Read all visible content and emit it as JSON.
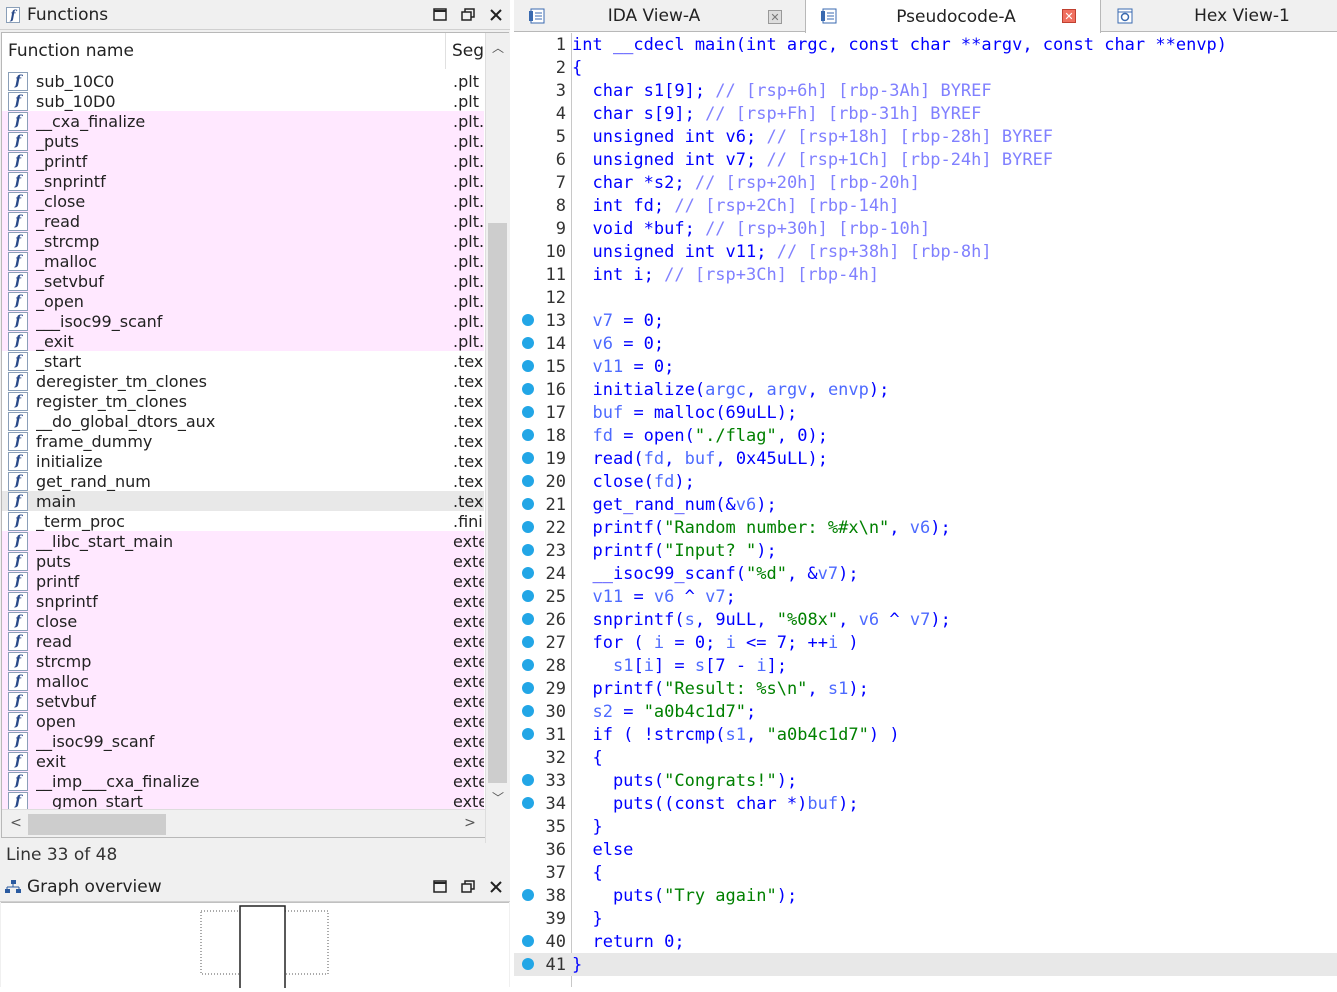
{
  "functions_panel": {
    "title": "Functions",
    "col_name": "Function name",
    "col_seg": "Seg",
    "rows": [
      {
        "name": "sub_10C0",
        "seg": ".plt",
        "pink": false
      },
      {
        "name": "sub_10D0",
        "seg": ".plt",
        "pink": false
      },
      {
        "name": "__cxa_finalize",
        "seg": ".plt.",
        "pink": true
      },
      {
        "name": "_puts",
        "seg": ".plt.",
        "pink": true
      },
      {
        "name": "_printf",
        "seg": ".plt.",
        "pink": true
      },
      {
        "name": "_snprintf",
        "seg": ".plt.",
        "pink": true
      },
      {
        "name": "_close",
        "seg": ".plt.",
        "pink": true
      },
      {
        "name": "_read",
        "seg": ".plt.",
        "pink": true
      },
      {
        "name": "_strcmp",
        "seg": ".plt.",
        "pink": true
      },
      {
        "name": "_malloc",
        "seg": ".plt.",
        "pink": true
      },
      {
        "name": "_setvbuf",
        "seg": ".plt.",
        "pink": true
      },
      {
        "name": "_open",
        "seg": ".plt.",
        "pink": true
      },
      {
        "name": "___isoc99_scanf",
        "seg": ".plt.s",
        "pink": true
      },
      {
        "name": "_exit",
        "seg": ".plt.",
        "pink": true
      },
      {
        "name": "_start",
        "seg": ".tex",
        "pink": false
      },
      {
        "name": "deregister_tm_clones",
        "seg": ".tex",
        "pink": false
      },
      {
        "name": "register_tm_clones",
        "seg": ".tex",
        "pink": false
      },
      {
        "name": "__do_global_dtors_aux",
        "seg": ".tex",
        "pink": false
      },
      {
        "name": "frame_dummy",
        "seg": ".tex",
        "pink": false
      },
      {
        "name": "initialize",
        "seg": ".tex",
        "pink": false
      },
      {
        "name": "get_rand_num",
        "seg": ".tex",
        "pink": false
      },
      {
        "name": "main",
        "seg": ".tex",
        "pink": false,
        "selected": true
      },
      {
        "name": "_term_proc",
        "seg": ".fini",
        "pink": false
      },
      {
        "name": "__libc_start_main",
        "seg": "exte",
        "pink": true
      },
      {
        "name": "puts",
        "seg": "exte",
        "pink": true
      },
      {
        "name": "printf",
        "seg": "exte",
        "pink": true
      },
      {
        "name": "snprintf",
        "seg": "exte",
        "pink": true
      },
      {
        "name": "close",
        "seg": "exte",
        "pink": true
      },
      {
        "name": "read",
        "seg": "exte",
        "pink": true
      },
      {
        "name": "strcmp",
        "seg": "exte",
        "pink": true
      },
      {
        "name": "malloc",
        "seg": "exte",
        "pink": true
      },
      {
        "name": "setvbuf",
        "seg": "exte",
        "pink": true
      },
      {
        "name": "open",
        "seg": "exte",
        "pink": true
      },
      {
        "name": "__isoc99_scanf",
        "seg": "exte",
        "pink": true
      },
      {
        "name": "exit",
        "seg": "exte",
        "pink": true
      },
      {
        "name": "__imp___cxa_finalize",
        "seg": "exte",
        "pink": true
      },
      {
        "name": "__gmon_start__",
        "seg": "exte",
        "pink": true
      }
    ],
    "status": "Line 33 of 48"
  },
  "graph_panel": {
    "title": "Graph overview"
  },
  "tabs": [
    {
      "label": "IDA View-A",
      "active": false,
      "icon": "ida-view-icon"
    },
    {
      "label": "Pseudocode-A",
      "active": true,
      "icon": "pseudocode-icon"
    },
    {
      "label": "Hex View-1",
      "active": false,
      "icon": "hex-view-icon"
    }
  ],
  "code_lines": [
    {
      "n": "1",
      "bp": false,
      "segs": [
        [
          "k",
          "int __cdecl main(int argc, const char **argv, const char **envp)"
        ]
      ]
    },
    {
      "n": "2",
      "bp": false,
      "segs": [
        [
          "k",
          "{"
        ]
      ]
    },
    {
      "n": "3",
      "bp": false,
      "segs": [
        [
          "k",
          "  char s1[9]; "
        ],
        [
          "cm",
          "// [rsp+6h] [rbp-3Ah] BYREF"
        ]
      ]
    },
    {
      "n": "4",
      "bp": false,
      "segs": [
        [
          "k",
          "  char s[9]; "
        ],
        [
          "cm",
          "// [rsp+Fh] [rbp-31h] BYREF"
        ]
      ]
    },
    {
      "n": "5",
      "bp": false,
      "segs": [
        [
          "k",
          "  unsigned int v6; "
        ],
        [
          "cm",
          "// [rsp+18h] [rbp-28h] BYREF"
        ]
      ]
    },
    {
      "n": "6",
      "bp": false,
      "segs": [
        [
          "k",
          "  unsigned int v7; "
        ],
        [
          "cm",
          "// [rsp+1Ch] [rbp-24h] BYREF"
        ]
      ]
    },
    {
      "n": "7",
      "bp": false,
      "segs": [
        [
          "k",
          "  char *s2; "
        ],
        [
          "cm",
          "// [rsp+20h] [rbp-20h]"
        ]
      ]
    },
    {
      "n": "8",
      "bp": false,
      "segs": [
        [
          "k",
          "  int fd; "
        ],
        [
          "cm",
          "// [rsp+2Ch] [rbp-14h]"
        ]
      ]
    },
    {
      "n": "9",
      "bp": false,
      "segs": [
        [
          "k",
          "  void *buf; "
        ],
        [
          "cm",
          "// [rsp+30h] [rbp-10h]"
        ]
      ]
    },
    {
      "n": "10",
      "bp": false,
      "segs": [
        [
          "k",
          "  unsigned int v11; "
        ],
        [
          "cm",
          "// [rsp+38h] [rbp-8h]"
        ]
      ]
    },
    {
      "n": "11",
      "bp": false,
      "segs": [
        [
          "k",
          "  int i; "
        ],
        [
          "cm",
          "// [rsp+3Ch] [rbp-4h]"
        ]
      ]
    },
    {
      "n": "12",
      "bp": false,
      "segs": [
        [
          "k",
          ""
        ]
      ]
    },
    {
      "n": "13",
      "bp": true,
      "segs": [
        [
          "k",
          "  "
        ],
        [
          "v",
          "v7"
        ],
        [
          "k",
          " = 0;"
        ]
      ]
    },
    {
      "n": "14",
      "bp": true,
      "segs": [
        [
          "k",
          "  "
        ],
        [
          "v",
          "v6"
        ],
        [
          "k",
          " = 0;"
        ]
      ]
    },
    {
      "n": "15",
      "bp": true,
      "segs": [
        [
          "k",
          "  "
        ],
        [
          "v",
          "v11"
        ],
        [
          "k",
          " = 0;"
        ]
      ]
    },
    {
      "n": "16",
      "bp": true,
      "segs": [
        [
          "k",
          "  initialize("
        ],
        [
          "v",
          "argc"
        ],
        [
          "k",
          ", "
        ],
        [
          "v",
          "argv"
        ],
        [
          "k",
          ", "
        ],
        [
          "v",
          "envp"
        ],
        [
          "k",
          ");"
        ]
      ]
    },
    {
      "n": "17",
      "bp": true,
      "segs": [
        [
          "k",
          "  "
        ],
        [
          "v",
          "buf"
        ],
        [
          "k",
          " = malloc(69uLL);"
        ]
      ]
    },
    {
      "n": "18",
      "bp": true,
      "segs": [
        [
          "k",
          "  "
        ],
        [
          "v",
          "fd"
        ],
        [
          "k",
          " = open("
        ],
        [
          "s",
          "\"./flag\""
        ],
        [
          "k",
          ", 0);"
        ]
      ]
    },
    {
      "n": "19",
      "bp": true,
      "segs": [
        [
          "k",
          "  read("
        ],
        [
          "v",
          "fd"
        ],
        [
          "k",
          ", "
        ],
        [
          "v",
          "buf"
        ],
        [
          "k",
          ", 0x45uLL);"
        ]
      ]
    },
    {
      "n": "20",
      "bp": true,
      "segs": [
        [
          "k",
          "  close("
        ],
        [
          "v",
          "fd"
        ],
        [
          "k",
          ");"
        ]
      ]
    },
    {
      "n": "21",
      "bp": true,
      "segs": [
        [
          "k",
          "  get_rand_num(&"
        ],
        [
          "v",
          "v6"
        ],
        [
          "k",
          ");"
        ]
      ]
    },
    {
      "n": "22",
      "bp": true,
      "segs": [
        [
          "k",
          "  printf("
        ],
        [
          "s",
          "\"Random number: %#x\\n\""
        ],
        [
          "k",
          ", "
        ],
        [
          "v",
          "v6"
        ],
        [
          "k",
          ");"
        ]
      ]
    },
    {
      "n": "23",
      "bp": true,
      "segs": [
        [
          "k",
          "  printf("
        ],
        [
          "s",
          "\"Input? \""
        ],
        [
          "k",
          ");"
        ]
      ]
    },
    {
      "n": "24",
      "bp": true,
      "segs": [
        [
          "k",
          "  __isoc99_scanf("
        ],
        [
          "s",
          "\"%d\""
        ],
        [
          "k",
          ", &"
        ],
        [
          "v",
          "v7"
        ],
        [
          "k",
          ");"
        ]
      ]
    },
    {
      "n": "25",
      "bp": true,
      "segs": [
        [
          "k",
          "  "
        ],
        [
          "v",
          "v11"
        ],
        [
          "k",
          " = "
        ],
        [
          "v",
          "v6"
        ],
        [
          "k",
          " ^ "
        ],
        [
          "v",
          "v7"
        ],
        [
          "k",
          ";"
        ]
      ]
    },
    {
      "n": "26",
      "bp": true,
      "segs": [
        [
          "k",
          "  snprintf("
        ],
        [
          "v",
          "s"
        ],
        [
          "k",
          ", 9uLL, "
        ],
        [
          "s",
          "\"%08x\""
        ],
        [
          "k",
          ", "
        ],
        [
          "v",
          "v6"
        ],
        [
          "k",
          " ^ "
        ],
        [
          "v",
          "v7"
        ],
        [
          "k",
          ");"
        ]
      ]
    },
    {
      "n": "27",
      "bp": true,
      "segs": [
        [
          "k",
          "  for ( "
        ],
        [
          "v",
          "i"
        ],
        [
          "k",
          " = 0; "
        ],
        [
          "v",
          "i"
        ],
        [
          "k",
          " <= 7; ++"
        ],
        [
          "v",
          "i"
        ],
        [
          "k",
          " )"
        ]
      ]
    },
    {
      "n": "28",
      "bp": true,
      "segs": [
        [
          "k",
          "    "
        ],
        [
          "v",
          "s1"
        ],
        [
          "k",
          "["
        ],
        [
          "v",
          "i"
        ],
        [
          "k",
          "] = "
        ],
        [
          "v",
          "s"
        ],
        [
          "k",
          "[7 - "
        ],
        [
          "v",
          "i"
        ],
        [
          "k",
          "];"
        ]
      ]
    },
    {
      "n": "29",
      "bp": true,
      "segs": [
        [
          "k",
          "  printf("
        ],
        [
          "s",
          "\"Result: %s\\n\""
        ],
        [
          "k",
          ", "
        ],
        [
          "v",
          "s1"
        ],
        [
          "k",
          ");"
        ]
      ]
    },
    {
      "n": "30",
      "bp": true,
      "segs": [
        [
          "k",
          "  "
        ],
        [
          "v",
          "s2"
        ],
        [
          "k",
          " = "
        ],
        [
          "s",
          "\"a0b4c1d7\""
        ],
        [
          "k",
          ";"
        ]
      ]
    },
    {
      "n": "31",
      "bp": true,
      "segs": [
        [
          "k",
          "  if ( !strcmp("
        ],
        [
          "v",
          "s1"
        ],
        [
          "k",
          ", "
        ],
        [
          "s",
          "\"a0b4c1d7\""
        ],
        [
          "k",
          ") )"
        ]
      ]
    },
    {
      "n": "32",
      "bp": false,
      "segs": [
        [
          "k",
          "  {"
        ]
      ]
    },
    {
      "n": "33",
      "bp": true,
      "segs": [
        [
          "k",
          "    puts("
        ],
        [
          "s",
          "\"Congrats!\""
        ],
        [
          "k",
          ");"
        ]
      ]
    },
    {
      "n": "34",
      "bp": true,
      "segs": [
        [
          "k",
          "    puts((const char *)"
        ],
        [
          "v",
          "buf"
        ],
        [
          "k",
          ");"
        ]
      ]
    },
    {
      "n": "35",
      "bp": false,
      "segs": [
        [
          "k",
          "  }"
        ]
      ]
    },
    {
      "n": "36",
      "bp": false,
      "segs": [
        [
          "k",
          "  else"
        ]
      ]
    },
    {
      "n": "37",
      "bp": false,
      "segs": [
        [
          "k",
          "  {"
        ]
      ]
    },
    {
      "n": "38",
      "bp": true,
      "segs": [
        [
          "k",
          "    puts("
        ],
        [
          "s",
          "\"Try again\""
        ],
        [
          "k",
          ");"
        ]
      ]
    },
    {
      "n": "39",
      "bp": false,
      "segs": [
        [
          "k",
          "  }"
        ]
      ]
    },
    {
      "n": "40",
      "bp": true,
      "segs": [
        [
          "k",
          "  return 0;"
        ]
      ]
    },
    {
      "n": "41",
      "bp": true,
      "hl": true,
      "segs": [
        [
          "k",
          "}"
        ]
      ]
    }
  ],
  "colors": {
    "breakpoint": "#22a6e6",
    "pink_row": "#ffe8ff",
    "string": "#008000",
    "variable": "#4d6aff",
    "comment": "#8080ff",
    "keyword": "#0000ff"
  }
}
